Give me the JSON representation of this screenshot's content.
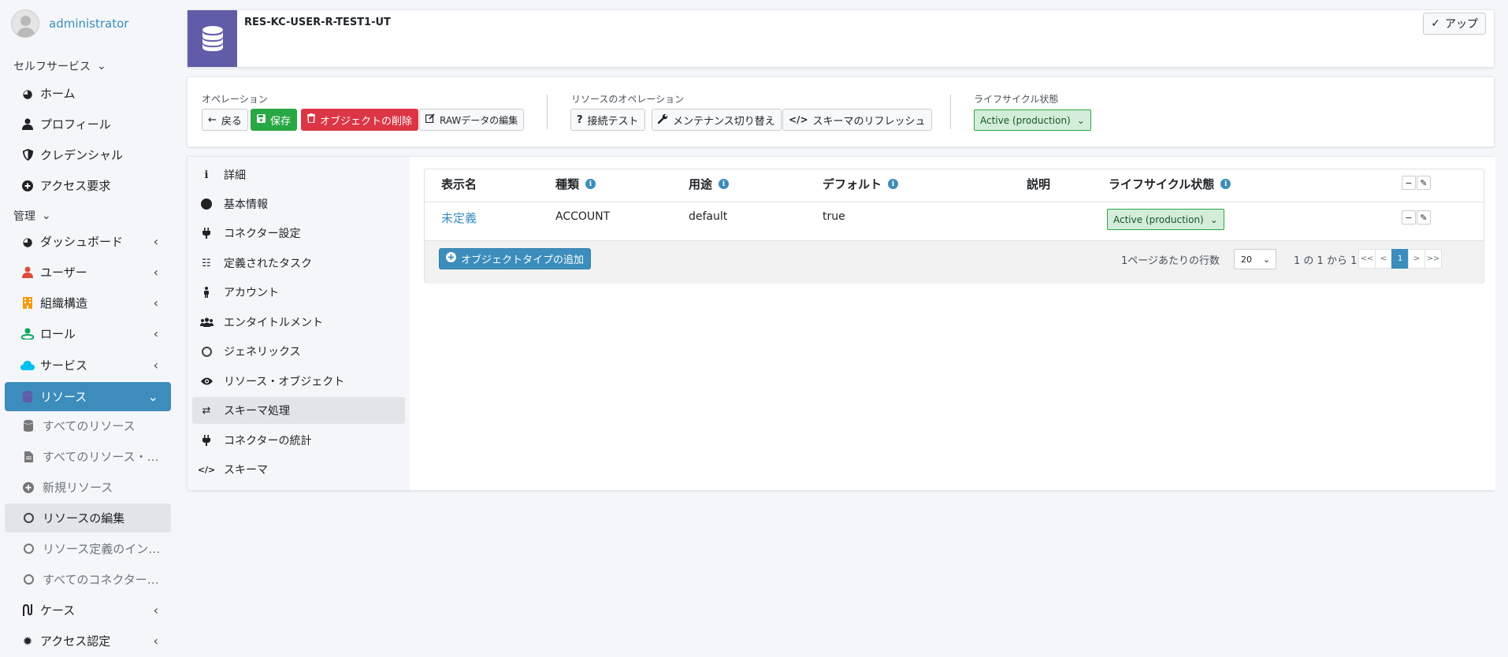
{
  "user": {
    "name": "administrator"
  },
  "sidebar": {
    "self_service_header": "セルフサービス",
    "self_service": [
      {
        "label": "ホーム",
        "icon": "dashboard-icon"
      },
      {
        "label": "プロフィール",
        "icon": "user-icon"
      },
      {
        "label": "クレデンシャル",
        "icon": "shield-icon"
      },
      {
        "label": "アクセス要求",
        "icon": "plus-circle-icon"
      }
    ],
    "admin_header": "管理",
    "admin": [
      {
        "label": "ダッシュボード",
        "icon": "dashboard-icon"
      },
      {
        "label": "ユーザー",
        "icon": "user-icon",
        "color": "#dd4b39"
      },
      {
        "label": "組織構造",
        "icon": "building-icon",
        "color": "#f39c12"
      },
      {
        "label": "ロール",
        "icon": "role-icon",
        "color": "#00a65a"
      },
      {
        "label": "サービス",
        "icon": "cloud-icon",
        "color": "#00c0ef"
      },
      {
        "label": "リソース",
        "icon": "database-icon",
        "color": "#605ca8"
      }
    ],
    "resource_sub": [
      {
        "label": "すべてのリソース",
        "icon": "database-icon"
      },
      {
        "label": "すべてのリソース・…",
        "icon": "file-icon"
      },
      {
        "label": "新規リソース",
        "icon": "plus-circle-icon"
      },
      {
        "label": "リソースの編集",
        "icon": "circle-icon"
      },
      {
        "label": "リソース定義のイン…",
        "icon": "circle-icon"
      },
      {
        "label": "すべてのコネクター…",
        "icon": "circle-icon"
      }
    ],
    "bottom": [
      {
        "label": "ケース",
        "icon": "route-icon"
      },
      {
        "label": "アクセス認定",
        "icon": "certificate-icon"
      }
    ]
  },
  "header": {
    "title": "RES-KC-USER-R-TEST1-UT",
    "up_button": "アップ"
  },
  "operations": {
    "label": "オペレーション",
    "back": "戻る",
    "save": "保存",
    "delete": "オブジェクトの削除",
    "edit_raw": "RAWデータの編集"
  },
  "resource_operations": {
    "label": "リソースのオペレーション",
    "test_connection": "接続テスト",
    "maintenance": "メンテナンス切り替え",
    "refresh_schema": "スキーマのリフレッシュ"
  },
  "lifecycle": {
    "label": "ライフサイクル状態",
    "value": "Active (production)"
  },
  "details_menu": [
    {
      "label": "詳細",
      "icon": "info-icon"
    },
    {
      "label": "基本情報",
      "icon": "dot-icon"
    },
    {
      "label": "コネクター設定",
      "icon": "plug-icon"
    },
    {
      "label": "定義されたタスク",
      "icon": "tasks-icon"
    },
    {
      "label": "アカウント",
      "icon": "male-icon"
    },
    {
      "label": "エンタイトルメント",
      "icon": "users-icon"
    },
    {
      "label": "ジェネリックス",
      "icon": "circle-icon"
    },
    {
      "label": "リソース・オブジェクト",
      "icon": "eye-icon"
    },
    {
      "label": "スキーマ処理",
      "icon": "exchange-icon"
    },
    {
      "label": "コネクターの統計",
      "icon": "plug-icon"
    },
    {
      "label": "スキーマ",
      "icon": "code-icon"
    }
  ],
  "table": {
    "headers": {
      "display_name": "表示名",
      "kind": "種類",
      "intent": "用途",
      "default": "デフォルト",
      "description": "説明",
      "lifecycle": "ライフサイクル状態"
    },
    "rows": [
      {
        "display_name": "未定義",
        "kind": "ACCOUNT",
        "intent": "default",
        "default": "true",
        "description": "",
        "lifecycle": "Active (production)"
      }
    ],
    "add_button": "オブジェクトタイプの追加",
    "rows_per_page_label": "1ページあたりの行数",
    "rows_per_page": "20",
    "range_text": "1 の 1 から 1",
    "pager": [
      "<<",
      "<",
      "1",
      ">",
      ">>"
    ]
  }
}
